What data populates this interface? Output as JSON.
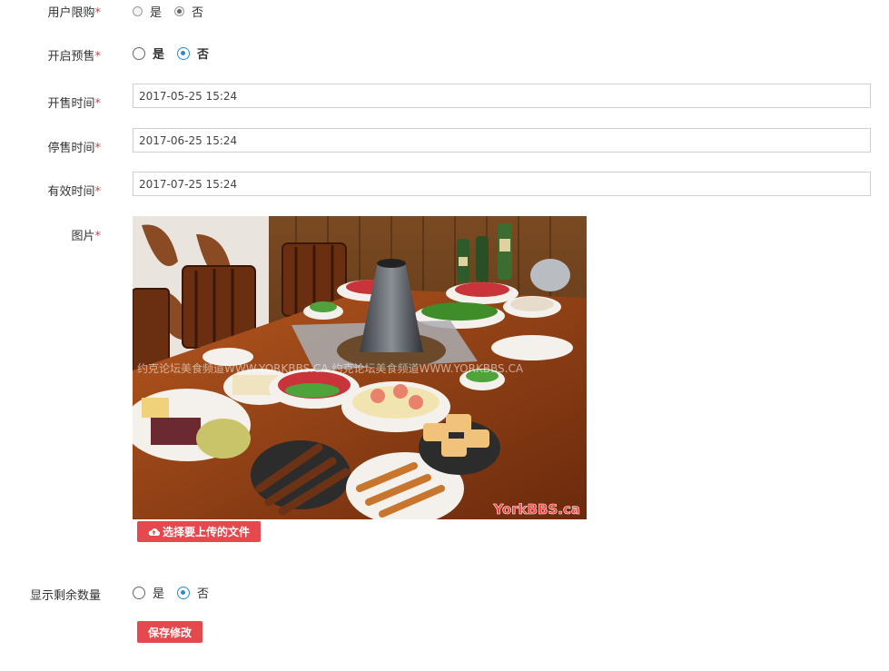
{
  "form": {
    "limit_purchase": {
      "label": "用户限购",
      "required": "*",
      "options": [
        "是",
        "否"
      ],
      "selected": "否"
    },
    "presale": {
      "label": "开启预售",
      "required": "*",
      "options": [
        "是",
        "否"
      ],
      "selected": "否"
    },
    "sale_start": {
      "label": "开售时间",
      "required": "*",
      "value": "2017-05-25 15:24"
    },
    "sale_end": {
      "label": "停售时间",
      "required": "*",
      "value": "2017-06-25 15:24"
    },
    "valid_time": {
      "label": "有效时间",
      "required": "*",
      "value": "2017-07-25 15:24"
    },
    "image": {
      "label": "图片",
      "required": "*",
      "watermark": "约克论坛美食频道WWW.YORKBBS.CA 约克论坛美食频道WWW.YORKBBS.CA",
      "brand_mark": "YorkBBS.ca",
      "upload_button": "选择要上传的文件",
      "upload_icon": "cloud-upload-icon"
    },
    "show_remaining": {
      "label": "显示剩余数量",
      "options": [
        "是",
        "否"
      ],
      "selected": "否"
    },
    "save_button": "保存修改"
  },
  "colors": {
    "required": "#e03c3c",
    "button": "#e5484d",
    "radio_checked": "#2a8ad4"
  }
}
